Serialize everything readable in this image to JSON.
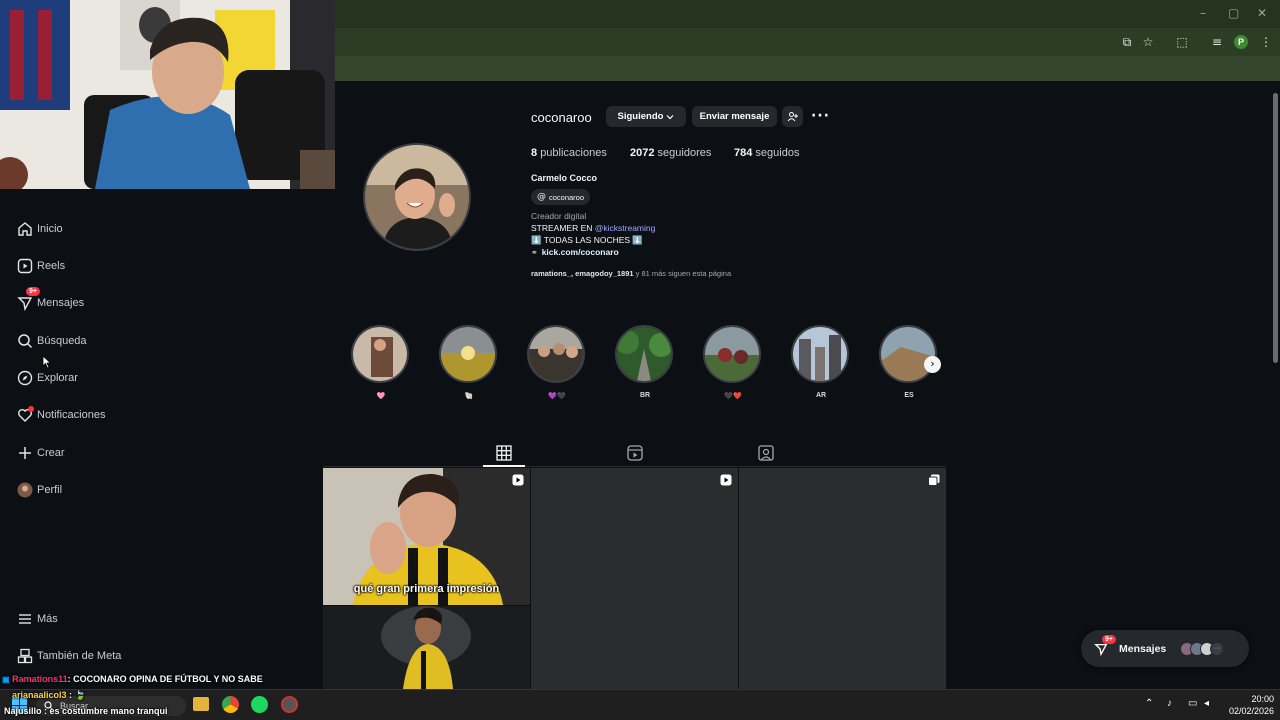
{
  "browser": {
    "win_minimize": "–",
    "win_maximize": "▢",
    "win_close": "✕",
    "profile_initial": "P"
  },
  "sidebar": {
    "items": [
      {
        "label": "Inicio",
        "icon": "home-icon"
      },
      {
        "label": "Reels",
        "icon": "reels-icon"
      },
      {
        "label": "Mensajes",
        "icon": "messenger-icon",
        "badge": "9+"
      },
      {
        "label": "Búsqueda",
        "icon": "search-icon"
      },
      {
        "label": "Explorar",
        "icon": "explore-icon"
      },
      {
        "label": "Notificaciones",
        "icon": "heart-icon"
      },
      {
        "label": "Crear",
        "icon": "plus-icon"
      },
      {
        "label": "Perfil",
        "icon": "avatar"
      }
    ],
    "more": "Más",
    "meta": "También de Meta"
  },
  "profile": {
    "username": "coconaroo",
    "following_btn": "Siguiendo",
    "message_btn": "Enviar mensaje",
    "posts_count": "8",
    "posts_label": "publicaciones",
    "followers_count": "2072",
    "followers_label": "seguidores",
    "following_count": "784",
    "following_label": "seguidos",
    "full_name": "Carmelo Cocco",
    "threads_handle": "coconaroo",
    "category": "Creador digital",
    "bio_line1_prefix": "STREAMER EN ",
    "bio_line1_link": "@kickstreaming",
    "bio_line2": "⬇️ TODAS LAS NOCHES ⬇️",
    "link": "kick.com/coconaro",
    "followed_by_names": "ramations_, emagodoy_1891",
    "followed_by_rest": " y 81 más siguen esta página"
  },
  "highlights": [
    {
      "label": "🩷"
    },
    {
      "label": "🐚"
    },
    {
      "label": "💜🖤"
    },
    {
      "label": "BR"
    },
    {
      "label": "🖤❤️"
    },
    {
      "label": "AR"
    },
    {
      "label": "ES"
    }
  ],
  "posts": [
    {
      "caption": "qué gran primera impresión",
      "type": "reel"
    },
    {
      "caption": "",
      "type": "reel"
    },
    {
      "caption": "",
      "type": "carousel"
    }
  ],
  "messages_pill": {
    "label": "Mensajes",
    "badge": "9+"
  },
  "chat": [
    {
      "user": "Ramations11",
      "message": ": COCONARO OPINA DE FÚTBOL Y NO SABE"
    },
    {
      "user": "arianaalicol3",
      "message": " : 🍃"
    },
    {
      "user": "Najusillo",
      "message": " : es costumbre mano tranqui"
    }
  ],
  "taskbar": {
    "search_label": "Buscar",
    "time": "20:00",
    "date": "02/02/2026"
  },
  "colors": {
    "bg": "#0c1014",
    "button": "#25292e",
    "link": "#e0f1ff",
    "mention": "#a0a7ff",
    "badge": "#ff3040",
    "browser_bar": "#2c3d26"
  }
}
